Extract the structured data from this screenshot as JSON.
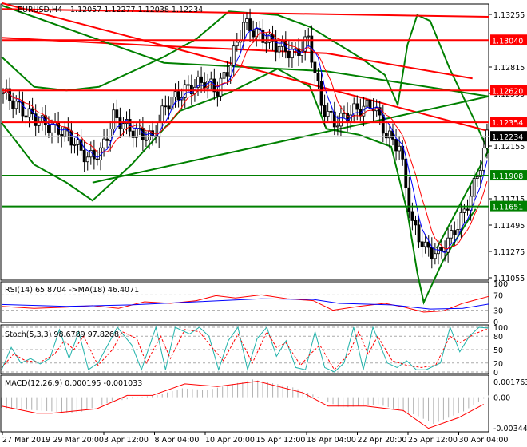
{
  "chart_data": {
    "type": "candlestick",
    "title": "EURUSD,H4",
    "ohlc_header": "1.12057 1.12277 1.12038 1.12234",
    "price_axis": {
      "min": 1.11055,
      "max": 1.13255,
      "ticks": [
        "1.13255",
        "1.12815",
        "1.12595",
        "1.12155",
        "1.11715",
        "1.11495",
        "1.11275",
        "1.11055"
      ]
    },
    "time_labels": [
      "27 Mar 2019",
      "29 Mar 20:00",
      "3 Apr 12:00",
      "8 Apr 04:00",
      "10 Apr 20:00",
      "15 Apr 12:00",
      "18 Apr 04:00",
      "22 Apr 20:00",
      "25 Apr 12:00",
      "30 Apr 04:00"
    ],
    "bars": 150,
    "close_path": [
      [
        0,
        1.126
      ],
      [
        6,
        1.1245
      ],
      [
        12,
        1.1235
      ],
      [
        20,
        1.1225
      ],
      [
        26,
        1.1205
      ],
      [
        30,
        1.121
      ],
      [
        34,
        1.124
      ],
      [
        40,
        1.1228
      ],
      [
        46,
        1.1222
      ],
      [
        50,
        1.125
      ],
      [
        56,
        1.1262
      ],
      [
        62,
        1.127
      ],
      [
        66,
        1.1262
      ],
      [
        70,
        1.1285
      ],
      [
        74,
        1.1318
      ],
      [
        78,
        1.131
      ],
      [
        84,
        1.13
      ],
      [
        90,
        1.1292
      ],
      [
        94,
        1.1305
      ],
      [
        98,
        1.125
      ],
      [
        102,
        1.1235
      ],
      [
        108,
        1.1245
      ],
      [
        114,
        1.125
      ],
      [
        118,
        1.1225
      ],
      [
        122,
        1.1215
      ],
      [
        126,
        1.115
      ],
      [
        130,
        1.113
      ],
      [
        134,
        1.1125
      ],
      [
        138,
        1.114
      ],
      [
        142,
        1.116
      ],
      [
        146,
        1.119
      ],
      [
        149,
        1.12234
      ]
    ],
    "horizontal_levels": [
      {
        "price": 1.1304,
        "label": "1.13040",
        "color": "#ff0000"
      },
      {
        "price": 1.1262,
        "label": "1.12620",
        "color": "#ff0000"
      },
      {
        "price": 1.12354,
        "label": "1.12354",
        "color": "#ff0000"
      },
      {
        "price": 1.11908,
        "label": "1.11908",
        "color": "#008000"
      },
      {
        "price": 1.11651,
        "label": "1.11651",
        "color": "#008000"
      }
    ],
    "current_price": {
      "price": 1.12234,
      "label": "1.12234"
    },
    "trendlines": [
      {
        "color": "#ff0000",
        "points": [
          [
            0,
            1.133
          ],
          [
            150,
            1.13235
          ]
        ]
      },
      {
        "color": "#ff0000",
        "points": [
          [
            0,
            1.1335
          ],
          [
            150,
            1.1228
          ]
        ]
      },
      {
        "color": "#008000",
        "points": [
          [
            28,
            1.1185
          ],
          [
            150,
            1.1257
          ]
        ]
      },
      {
        "color": "#008000",
        "points": [
          [
            134,
            1.113
          ],
          [
            150,
            1.1212
          ]
        ]
      }
    ],
    "moving_averages": [
      {
        "color": "#ff0000",
        "points": [
          [
            0,
            1.1306
          ],
          [
            50,
            1.1299
          ],
          [
            100,
            1.1293
          ],
          [
            145,
            1.1272
          ]
        ]
      },
      {
        "color": "#008000",
        "points": [
          [
            0,
            1.1333
          ],
          [
            50,
            1.1285
          ],
          [
            100,
            1.1278
          ],
          [
            150,
            1.1257
          ]
        ]
      }
    ],
    "bollinger": {
      "color": "#008000",
      "upper": [
        [
          0,
          1.129
        ],
        [
          10,
          1.1265
        ],
        [
          20,
          1.1262
        ],
        [
          30,
          1.1265
        ],
        [
          50,
          1.129
        ],
        [
          60,
          1.1305
        ],
        [
          70,
          1.1328
        ],
        [
          85,
          1.1325
        ],
        [
          95,
          1.1315
        ],
        [
          110,
          1.129
        ],
        [
          118,
          1.1275
        ],
        [
          122,
          1.125
        ],
        [
          125,
          1.13
        ],
        [
          128,
          1.1325
        ],
        [
          132,
          1.132
        ],
        [
          138,
          1.128
        ],
        [
          146,
          1.1235
        ],
        [
          150,
          1.121
        ]
      ],
      "lower": [
        [
          0,
          1.1235
        ],
        [
          10,
          1.12
        ],
        [
          20,
          1.1185
        ],
        [
          28,
          1.117
        ],
        [
          40,
          1.12
        ],
        [
          55,
          1.1245
        ],
        [
          70,
          1.126
        ],
        [
          85,
          1.128
        ],
        [
          95,
          1.1265
        ],
        [
          100,
          1.123
        ],
        [
          110,
          1.1225
        ],
        [
          120,
          1.1215
        ],
        [
          125,
          1.116
        ],
        [
          128,
          1.111
        ],
        [
          130,
          1.1085
        ],
        [
          136,
          1.112
        ],
        [
          144,
          1.1155
        ],
        [
          146,
          1.1163
        ]
      ]
    },
    "indicators": {
      "rsi": {
        "label": "RSI(14) 65.8704  ->MA(18) 46.4071",
        "levels": [
          "100",
          "70",
          "30",
          "0"
        ],
        "rsi": [
          [
            0,
            40
          ],
          [
            10,
            35
          ],
          [
            20,
            38
          ],
          [
            28,
            42
          ],
          [
            36,
            35
          ],
          [
            44,
            52
          ],
          [
            52,
            48
          ],
          [
            60,
            55
          ],
          [
            66,
            68
          ],
          [
            72,
            62
          ],
          [
            80,
            70
          ],
          [
            88,
            60
          ],
          [
            96,
            55
          ],
          [
            102,
            30
          ],
          [
            110,
            40
          ],
          [
            118,
            48
          ],
          [
            124,
            38
          ],
          [
            130,
            25
          ],
          [
            136,
            28
          ],
          [
            142,
            48
          ],
          [
            146,
            57
          ],
          [
            150,
            66
          ]
        ],
        "ma": [
          [
            0,
            45
          ],
          [
            20,
            40
          ],
          [
            40,
            44
          ],
          [
            60,
            52
          ],
          [
            80,
            60
          ],
          [
            96,
            58
          ],
          [
            104,
            48
          ],
          [
            120,
            44
          ],
          [
            132,
            33
          ],
          [
            142,
            35
          ],
          [
            150,
            46
          ]
        ]
      },
      "stoch": {
        "label": "Stoch(5,3,3) 98.6789 97.8268",
        "levels": [
          "100",
          "80",
          "50",
          "20",
          "0"
        ],
        "k": [
          [
            0,
            5
          ],
          [
            4,
            55
          ],
          [
            8,
            20
          ],
          [
            12,
            30
          ],
          [
            16,
            18
          ],
          [
            20,
            30
          ],
          [
            24,
            95
          ],
          [
            28,
            30
          ],
          [
            32,
            90
          ],
          [
            36,
            5
          ],
          [
            40,
            20
          ],
          [
            44,
            60
          ],
          [
            48,
            100
          ],
          [
            54,
            60
          ],
          [
            58,
            5
          ],
          [
            64,
            100
          ],
          [
            68,
            5
          ],
          [
            72,
            100
          ],
          [
            78,
            85
          ],
          [
            82,
            100
          ],
          [
            86,
            80
          ],
          [
            90,
            5
          ],
          [
            94,
            70
          ],
          [
            98,
            100
          ],
          [
            102,
            5
          ],
          [
            106,
            75
          ],
          [
            110,
            100
          ],
          [
            114,
            35
          ],
          [
            118,
            70
          ],
          [
            122,
            10
          ],
          [
            126,
            5
          ],
          [
            130,
            90
          ],
          [
            134,
            10
          ],
          [
            138,
            0
          ],
          [
            142,
            20
          ],
          [
            146,
            100
          ],
          [
            150,
            5
          ],
          [
            154,
            100
          ],
          [
            160,
            20
          ],
          [
            164,
            10
          ],
          [
            168,
            25
          ],
          [
            172,
            5
          ],
          [
            176,
            5
          ],
          [
            182,
            20
          ],
          [
            186,
            100
          ],
          [
            190,
            45
          ],
          [
            194,
            80
          ],
          [
            198,
            100
          ],
          [
            202,
            98
          ]
        ],
        "d": [
          [
            0,
            10
          ],
          [
            5,
            40
          ],
          [
            10,
            25
          ],
          [
            16,
            22
          ],
          [
            22,
            40
          ],
          [
            26,
            70
          ],
          [
            30,
            50
          ],
          [
            34,
            80
          ],
          [
            40,
            15
          ],
          [
            46,
            50
          ],
          [
            50,
            90
          ],
          [
            56,
            75
          ],
          [
            60,
            20
          ],
          [
            66,
            80
          ],
          [
            70,
            30
          ],
          [
            76,
            95
          ],
          [
            82,
            90
          ],
          [
            88,
            50
          ],
          [
            92,
            25
          ],
          [
            98,
            85
          ],
          [
            104,
            20
          ],
          [
            110,
            90
          ],
          [
            114,
            55
          ],
          [
            118,
            65
          ],
          [
            124,
            15
          ],
          [
            128,
            40
          ],
          [
            132,
            60
          ],
          [
            138,
            5
          ],
          [
            144,
            40
          ],
          [
            148,
            90
          ],
          [
            152,
            40
          ],
          [
            156,
            80
          ],
          [
            162,
            25
          ],
          [
            168,
            15
          ],
          [
            174,
            10
          ],
          [
            180,
            15
          ],
          [
            186,
            80
          ],
          [
            190,
            65
          ],
          [
            196,
            85
          ],
          [
            202,
            97
          ]
        ]
      },
      "macd": {
        "label": "MACD(12,26,9) 0.000195 -0.001033",
        "levels": [
          "0.001763",
          "0.00",
          "-0.003444"
        ],
        "min": -0.003444,
        "max": 0.001763,
        "signal": [
          [
            0,
            -0.001
          ],
          [
            14,
            -0.0018
          ],
          [
            20,
            -0.0018
          ],
          [
            38,
            -0.0013
          ],
          [
            50,
            0.0002
          ],
          [
            60,
            0.0002
          ],
          [
            73,
            0.0015
          ],
          [
            86,
            0.0012
          ],
          [
            102,
            0.0018
          ],
          [
            120,
            0.0005
          ],
          [
            130,
            -0.001
          ],
          [
            145,
            -0.001
          ],
          [
            160,
            -0.0015
          ],
          [
            170,
            -0.0035
          ],
          [
            182,
            -0.0023
          ],
          [
            192,
            -0.0008
          ]
        ],
        "hist": [
          [
            0,
            -0.0012
          ],
          [
            30,
            -0.0018
          ],
          [
            44,
            -0.0005
          ],
          [
            55,
            0.0
          ],
          [
            63,
            0.0003
          ],
          [
            72,
            0.001
          ],
          [
            82,
            0.0008
          ],
          [
            100,
            0.002
          ],
          [
            115,
            0.0012
          ],
          [
            125,
            0.0002
          ],
          [
            135,
            -0.0012
          ],
          [
            150,
            -0.0008
          ],
          [
            165,
            -0.002
          ],
          [
            172,
            -0.003
          ],
          [
            184,
            -0.0016
          ],
          [
            194,
            0.0002
          ]
        ]
      }
    }
  }
}
